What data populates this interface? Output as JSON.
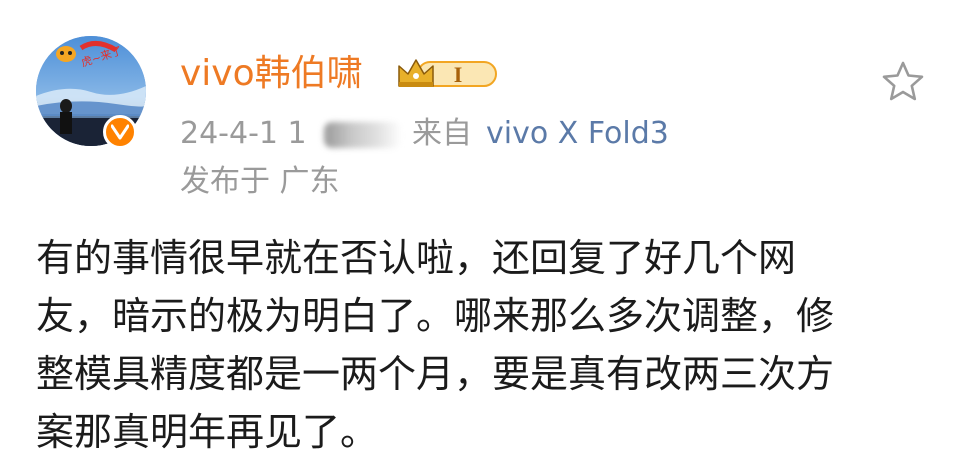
{
  "post": {
    "username": "vivo韩伯啸",
    "member_badge": {
      "icon": "crown-icon",
      "level": "I",
      "color": "#f2a623"
    },
    "timestamp": "24-4-1 1",
    "source_prefix": "来自",
    "device": "vivo X Fold3",
    "location": "发布于 广东",
    "avatar": {
      "icon": "avatar-photo",
      "caption": "虎~来了"
    },
    "verified_icon": "verified-v-icon",
    "favorite_icon": "star-outline-icon",
    "body_lines": [
      "有的事情很早就在否认啦，还回复了好几个网",
      "友，暗示的极为明白了。哪来那么多次调整，修",
      "整模具精度都是一两个月，要是真有改两三次方",
      "案那真明年再见了。"
    ]
  },
  "colors": {
    "username": "#ee7a24",
    "meta_gray": "#9a9a9a",
    "device_link": "#5b7aa8",
    "body_text": "#1b1b1b",
    "verified": "#ff8200"
  }
}
